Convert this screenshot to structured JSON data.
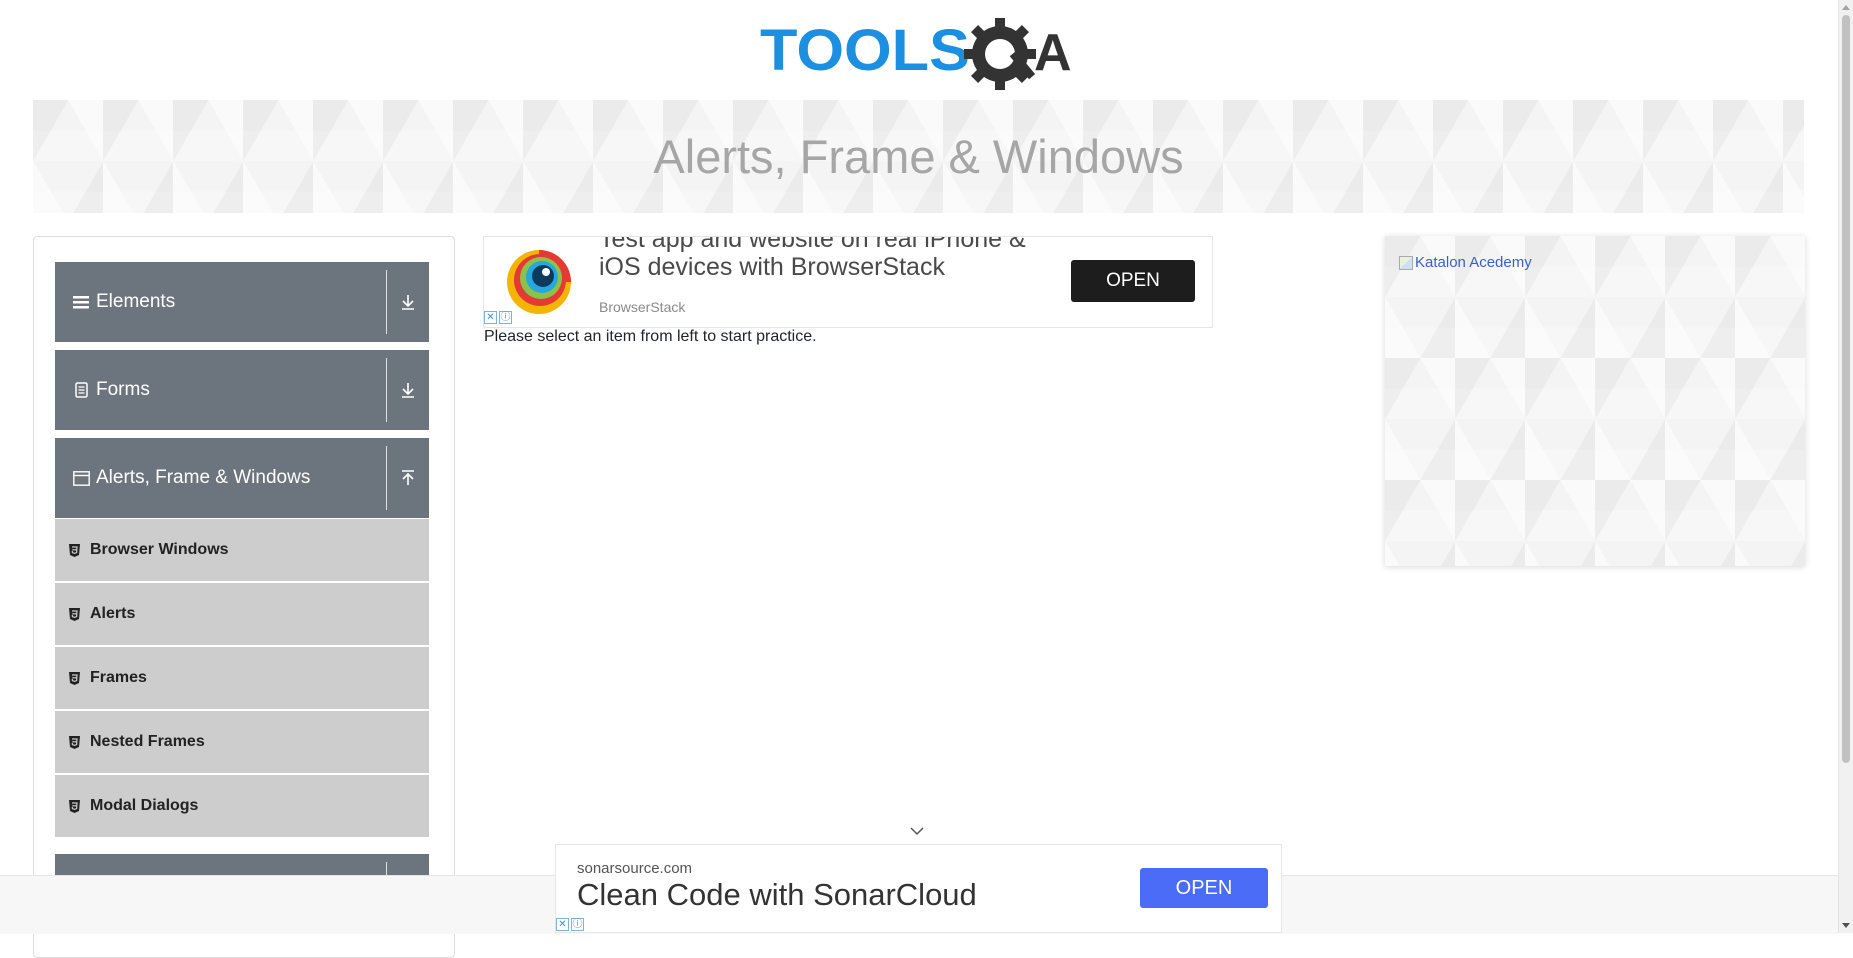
{
  "logo": {
    "text_tools": "TOOLS",
    "text_qa": "QA",
    "colors": {
      "tools": "#1d8fe1",
      "qa": "#333333"
    }
  },
  "banner": {
    "title": "Alerts, Frame & Windows"
  },
  "sidebar": {
    "groups": [
      {
        "label": "Elements",
        "icon": "hamburger-icon",
        "arrow": "download-arrow-icon"
      },
      {
        "label": "Forms",
        "icon": "document-icon",
        "arrow": "download-arrow-icon"
      },
      {
        "label": "Alerts, Frame & Windows",
        "icon": "window-icon",
        "arrow": "upload-arrow-icon"
      }
    ],
    "items": [
      {
        "label": "Browser Windows"
      },
      {
        "label": "Alerts"
      },
      {
        "label": "Frames"
      },
      {
        "label": "Nested Frames"
      },
      {
        "label": "Modal Dialogs"
      }
    ]
  },
  "ad_top": {
    "headline_line1": "Test app and website on real iPhone &",
    "headline_line2": "iOS devices with BrowserStack",
    "source": "BrowserStack",
    "button": "OPEN"
  },
  "instruction": "Please select an item from left to start practice.",
  "right_ad": {
    "alt_text": "Katalon Acedemy"
  },
  "ad_bottom": {
    "domain": "sonarsource.com",
    "headline": "Clean Code with SonarCloud",
    "button": "OPEN",
    "button_color": "#4a6cf7"
  },
  "colors": {
    "sidebar_group": "#6c757d",
    "sidebar_item": "#cdcdcd"
  }
}
